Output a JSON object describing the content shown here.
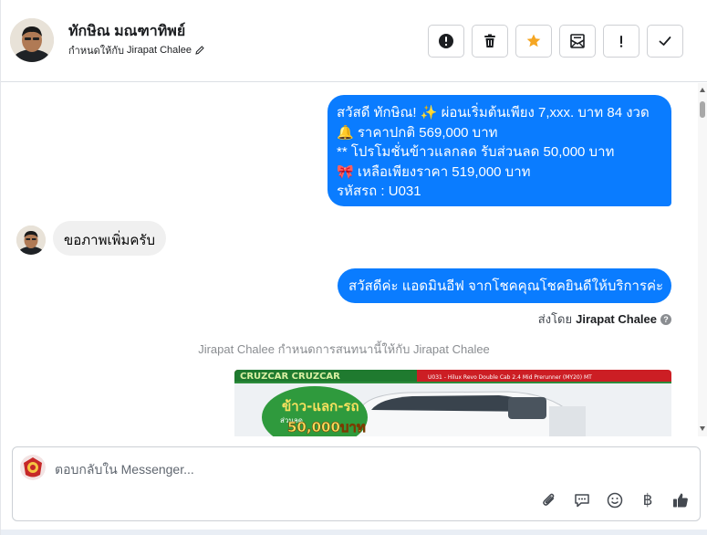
{
  "header": {
    "contact_name": "ทักษิณ มณฑาทิพย์",
    "assigned_prefix": "กำหนดให้กับ",
    "assigned_to": "Jirapat Chalee",
    "actions": [
      {
        "name": "report-button",
        "icon": "alert-circle-icon"
      },
      {
        "name": "delete-button",
        "icon": "trash-icon"
      },
      {
        "name": "star-button",
        "icon": "star-icon"
      },
      {
        "name": "mark-unread-button",
        "icon": "envelope-icon"
      },
      {
        "name": "important-button",
        "icon": "exclamation-icon"
      },
      {
        "name": "done-button",
        "icon": "check-icon"
      }
    ]
  },
  "messages": {
    "outgoing_promo": {
      "line1": "สวัสดี ทักษิณ! ✨  ผ่อนเริ่มต้นเพียง 7,xxx. บาท 84 งวด",
      "line2": "🔔 ราคาปกติ 569,000 บาท",
      "line3": "** โปรโมชั่นข้าวแลกลด รับส่วนลด 50,000 บาท",
      "line4": "🎀  เหลือเพียงราคา 519,000 บาท",
      "line5": " รหัสรถ : U031"
    },
    "incoming": "ขอภาพเพิ่มครับ",
    "outgoing_greeting": "สวัสดีค่ะ แอดมินอีฟ จากโชคคุณโชคยินดีให้บริการค่ะ",
    "sent_by_prefix": "ส่งโดย",
    "sent_by_name": "Jirapat Chalee",
    "system_note": "Jirapat Chalee กำหนดการสนทนานี้ให้กับ Jirapat Chalee",
    "promo_image": {
      "banner_left": "CRUZCAR CRUZCAR",
      "banner_right": "U031 - Hilux Revo Double Cab 2.4 Mid Prerunner (MY20) MT",
      "badge_text": "ข้าว-แลก-รถ",
      "badge_sub": "ส่วนลด",
      "badge_amount": "50,000บาท"
    }
  },
  "composer": {
    "placeholder": "ตอบกลับใน Messenger...",
    "tools": [
      "attach-icon",
      "chat-icon",
      "emoji-icon",
      "baht-icon",
      "like-icon"
    ],
    "baht_symbol": "฿"
  },
  "colors": {
    "outgoing_bubble": "#0a7cff",
    "incoming_bubble": "#f0f0f0",
    "star": "#f5a623"
  }
}
